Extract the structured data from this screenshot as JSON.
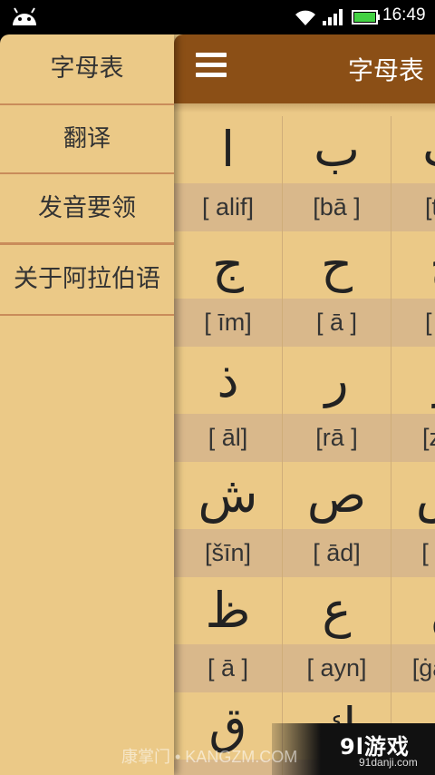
{
  "status_bar": {
    "time": "16:49"
  },
  "app_bar": {
    "title": "字母表"
  },
  "drawer": {
    "items": [
      {
        "label": "字母表"
      },
      {
        "label": "翻译"
      },
      {
        "label": "发音要领"
      },
      {
        "label": "关于阿拉伯语"
      }
    ]
  },
  "letters": [
    [
      {
        "letter": "ا",
        "translit": "[ alif]"
      },
      {
        "letter": "ب",
        "translit": "[bā ]"
      },
      {
        "letter": "ت",
        "translit": "[tā ]"
      }
    ],
    [
      {
        "letter": "ج",
        "translit": "[ īm]"
      },
      {
        "letter": "ح",
        "translit": "[ ā ]"
      },
      {
        "letter": "خ",
        "translit": "[ ā ]"
      }
    ],
    [
      {
        "letter": "ذ",
        "translit": "[ āl]"
      },
      {
        "letter": "ر",
        "translit": "[rā ]"
      },
      {
        "letter": "ز",
        "translit": "[zā ]"
      }
    ],
    [
      {
        "letter": "ش",
        "translit": "[šīn]"
      },
      {
        "letter": "ص",
        "translit": "[ ād]"
      },
      {
        "letter": "ض",
        "translit": "[ ād]"
      }
    ],
    [
      {
        "letter": "ظ",
        "translit": "[ ā ]"
      },
      {
        "letter": "ع",
        "translit": "[ ayn]"
      },
      {
        "letter": "غ",
        "translit": "[ġayn]"
      }
    ],
    [
      {
        "letter": "ق",
        "translit": ""
      },
      {
        "letter": "ك",
        "translit": ""
      },
      {
        "letter": "ل",
        "translit": ""
      }
    ]
  ],
  "watermark": {
    "text": "康掌门 • KANGZM.COM"
  },
  "logo": {
    "brand": "9l游戏",
    "site": "91danji.com"
  }
}
